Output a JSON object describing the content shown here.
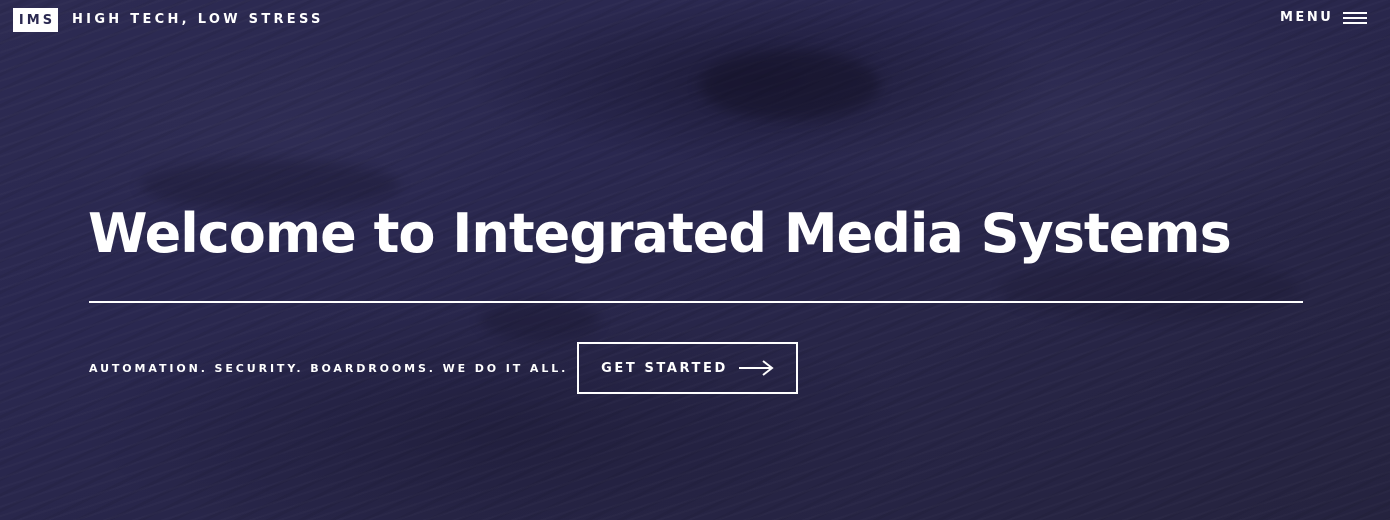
{
  "header": {
    "logo_text": "IMS",
    "tagline": "HIGH TECH, LOW STRESS",
    "menu_label": "MENU"
  },
  "hero": {
    "headline": "Welcome to Integrated Media Systems",
    "subtext": "AUTOMATION. SECURITY. BOARDROOMS. WE DO IT ALL.",
    "cta_label": "GET STARTED"
  },
  "icons": {
    "menu": "hamburger-icon",
    "cta": "arrow-right-icon"
  },
  "colors": {
    "background": "#28264a",
    "text": "#ffffff",
    "logo_text": "#2a2850"
  }
}
